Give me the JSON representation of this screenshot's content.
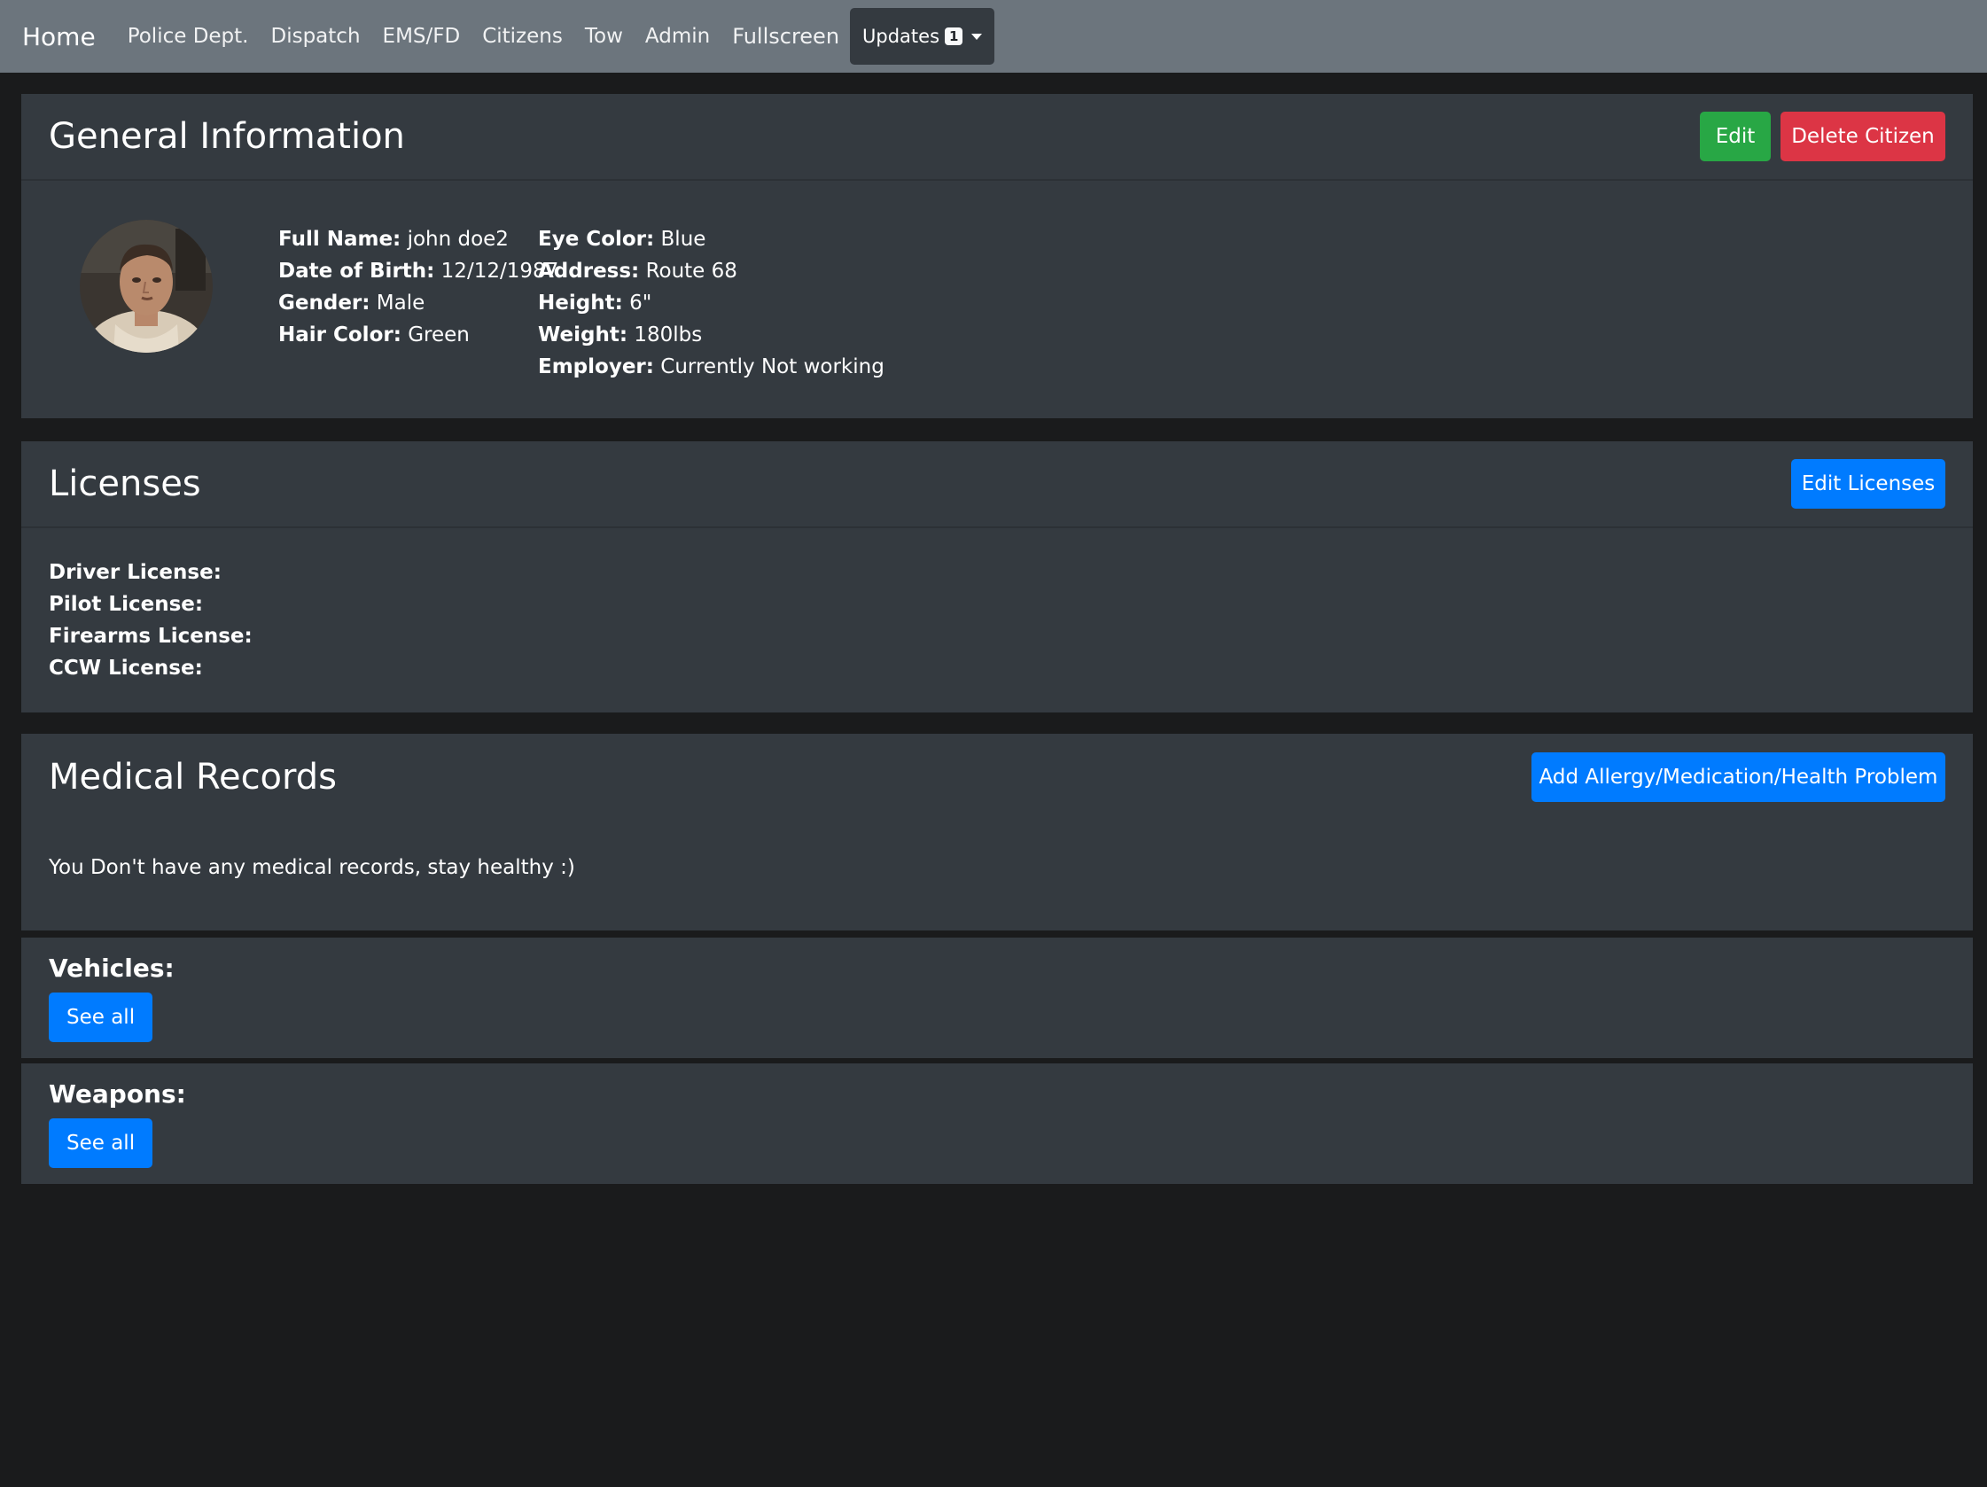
{
  "nav": {
    "brand": "Home",
    "links": [
      "Police Dept.",
      "Dispatch",
      "EMS/FD",
      "Citizens",
      "Tow",
      "Admin"
    ],
    "fullscreen": "Fullscreen",
    "updates_label": "Updates",
    "updates_badge": "1"
  },
  "general": {
    "title": "General Information",
    "edit_label": "Edit",
    "delete_label": "Delete Citizen",
    "left": [
      {
        "label": "Full Name:",
        "value": "john doe2"
      },
      {
        "label": "Date of Birth:",
        "value": "12/12/1987"
      },
      {
        "label": "Gender:",
        "value": "Male"
      },
      {
        "label": "Hair Color:",
        "value": "Green"
      }
    ],
    "right": [
      {
        "label": "Eye Color:",
        "value": "Blue"
      },
      {
        "label": "Address:",
        "value": "Route 68"
      },
      {
        "label": "Height:",
        "value": "6\""
      },
      {
        "label": "Weight:",
        "value": "180lbs"
      },
      {
        "label": "Employer:",
        "value": "Currently Not working"
      }
    ]
  },
  "licenses": {
    "title": "Licenses",
    "edit_label": "Edit Licenses",
    "items": [
      "Driver License:",
      "Pilot License:",
      "Firearms License:",
      "CCW License:"
    ]
  },
  "medical": {
    "title": "Medical Records",
    "add_label": "Add Allergy/Medication/Health Problem",
    "empty_text": "You Don't have any medical records, stay healthy :)"
  },
  "vehicles": {
    "label": "Vehicles:",
    "button": "See all"
  },
  "weapons": {
    "label": "Weapons:",
    "button": "See all"
  },
  "colors": {
    "navbar": "#6c757d",
    "card": "#343a40",
    "page": "#1a1b1c",
    "primary": "#007bff",
    "success": "#28a745",
    "danger": "#dc3545"
  }
}
